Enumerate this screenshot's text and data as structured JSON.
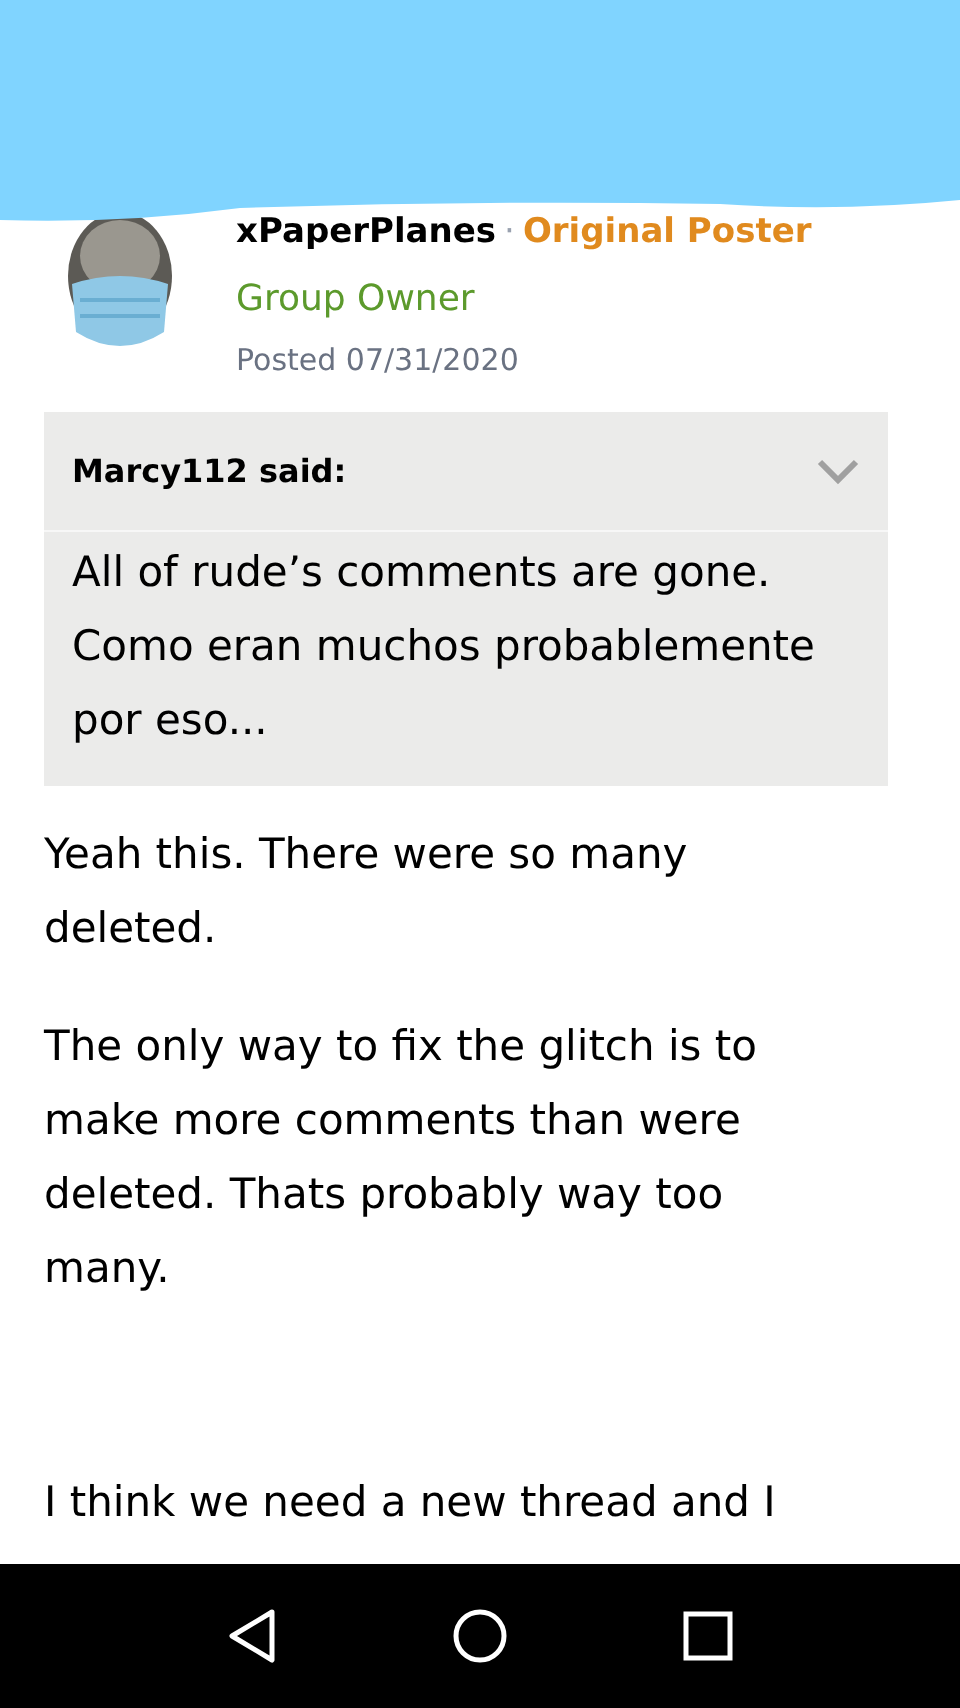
{
  "post": {
    "author": "xPaperPlanes",
    "separator": "·",
    "badge": "Original Poster",
    "role": "Group Owner",
    "posted": "Posted 07/31/2020"
  },
  "quote": {
    "author": "Marcy112 said:",
    "expanded": false,
    "text": "All of rude’s comments are gone. Como eran muchos probablemente por eso..."
  },
  "paragraphs": [
    "Yeah this. There were so many deleted.",
    "The only way to fix the glitch is to make more comments than were deleted. Thats probably way too many.",
    "I think we need a new thread and I"
  ]
}
